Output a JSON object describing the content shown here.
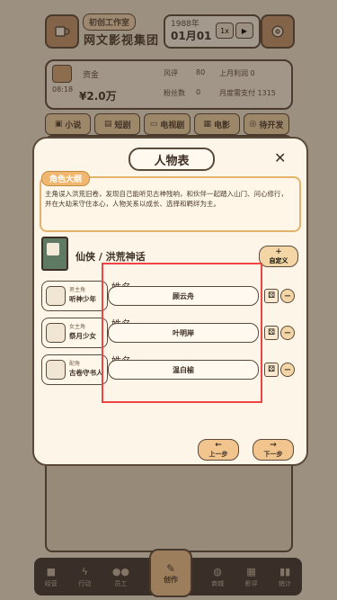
{
  "header": {
    "studio_tag": "初创工作室",
    "company": "网文影视集团",
    "year": "1988年",
    "date": "01月01",
    "speed": "1x",
    "play_icon": "play-icon",
    "gear_icon": "gear-icon"
  },
  "stats": {
    "funds_label": "资金",
    "funds_value": "¥2.0万",
    "reputation_label": "风评",
    "reputation_value": "80",
    "followers_label": "粉丝数",
    "followers_value": "0",
    "last_profit": "上月利润 0",
    "monthly_cost": "月度需支付 1315",
    "time": "08:18"
  },
  "tabs": [
    {
      "label": "小说",
      "icon": "book-icon"
    },
    {
      "label": "短剧",
      "icon": "film-icon"
    },
    {
      "label": "电视剧",
      "icon": "tv-icon"
    },
    {
      "label": "电影",
      "icon": "clapper-icon"
    },
    {
      "label": "待开发",
      "icon": "gamepad-icon"
    }
  ],
  "modal": {
    "title": "人物表",
    "outline_tag": "角色大纲",
    "outline_text": "主角误入洪荒旧卷，发现自己能听见古神残响，和伙伴一起踏入山门、问心修行，并在大劫来守住本心，人物关系以成长、选择和羁绊为主。",
    "genre": "仙侠 / 洪荒神话",
    "custom_label": "自定义",
    "custom_plus": "+",
    "name_label": "姓名",
    "roles": [
      {
        "type": "男主角",
        "title": "听神少年",
        "name": "顾云舟"
      },
      {
        "type": "女主角",
        "title": "祭月少女",
        "name": "叶明岸"
      },
      {
        "type": "配角",
        "title": "古卷守书人",
        "name": "温白榆"
      }
    ],
    "prev_label": "上一步",
    "next_label": "下一步"
  },
  "bottom_nav": [
    {
      "label": "经营",
      "icon": "briefcase-icon"
    },
    {
      "label": "行动",
      "icon": "bolt-icon"
    },
    {
      "label": "员工",
      "icon": "people-icon"
    },
    {
      "label": "创作",
      "icon": "pen-icon"
    },
    {
      "label": "商城",
      "icon": "globe-icon"
    },
    {
      "label": "影评",
      "icon": "clapper-icon"
    },
    {
      "label": "统计",
      "icon": "bars-icon"
    }
  ]
}
